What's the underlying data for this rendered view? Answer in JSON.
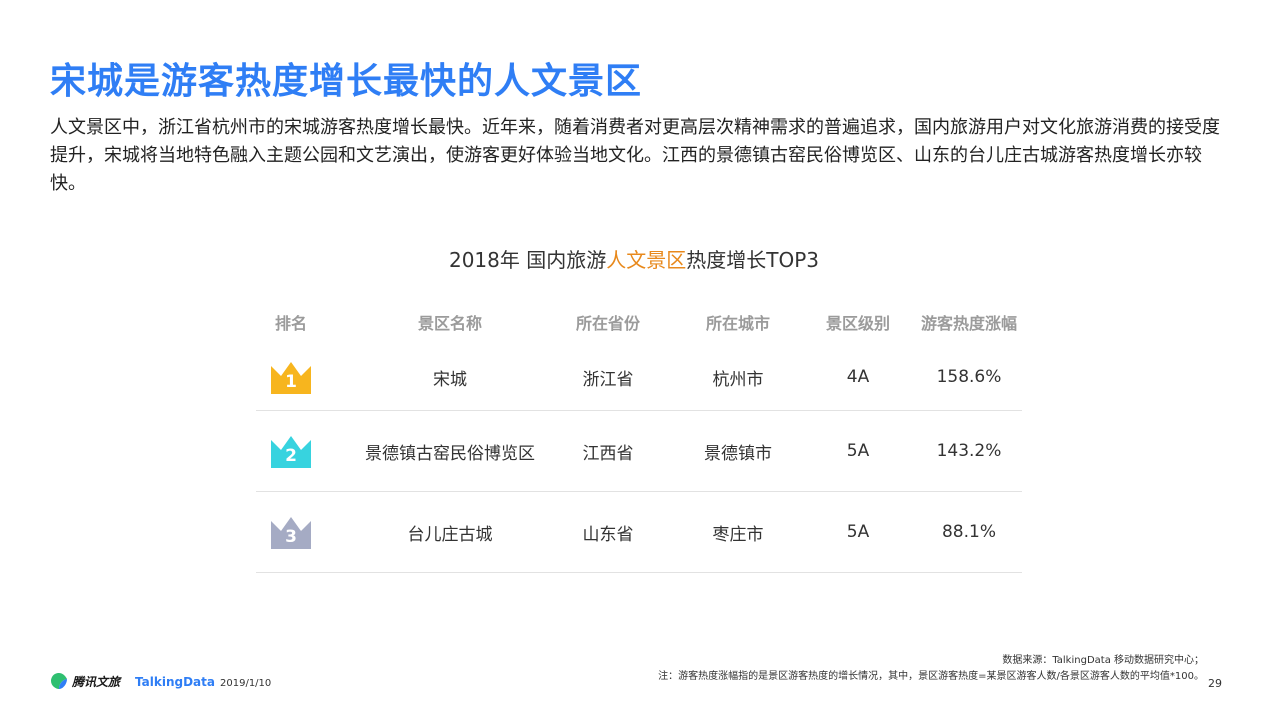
{
  "title": "宋城是游客热度增长最快的人文景区",
  "intro": "人文景区中，浙江省杭州市的宋城游客热度增长最快。近年来，随着消费者对更高层次精神需求的普遍追求，国内旅游用户对文化旅游消费的接受度提升，宋城将当地特色融入主题公园和文艺演出，使游客更好体验当地文化。江西的景德镇古窑民俗博览区、山东的台儿庄古城游客热度增长亦较快。",
  "table": {
    "title_prefix": "2018年 国内旅游",
    "title_highlight": "人文景区",
    "title_suffix": "热度增长TOP3",
    "headers": {
      "rank": "排名",
      "name": "景区名称",
      "province": "所在省份",
      "city": "所在城市",
      "level": "景区级别",
      "growth": "游客热度涨幅"
    },
    "rows": [
      {
        "rank": "1",
        "name": "宋城",
        "province": "浙江省",
        "city": "杭州市",
        "level": "4A",
        "growth": "158.6%"
      },
      {
        "rank": "2",
        "name": "景德镇古窑民俗博览区",
        "province": "江西省",
        "city": "景德镇市",
        "level": "5A",
        "growth": "143.2%"
      },
      {
        "rank": "3",
        "name": "台儿庄古城",
        "province": "山东省",
        "city": "枣庄市",
        "level": "5A",
        "growth": "88.1%"
      }
    ],
    "crown_colors": [
      "#f7b51e",
      "#37d3df",
      "#a5abc4"
    ]
  },
  "footer": {
    "brand1": "腾讯文旅",
    "brand2": "TalkingData",
    "date": "2019/1/10",
    "source": "数据来源：TalkingData 移动数据研究中心；",
    "note": "注：游客热度涨幅指的是景区游客热度的增长情况，其中，景区游客热度=某景区游客人数/各景区游客人数的平均值*100。",
    "page": "29"
  }
}
